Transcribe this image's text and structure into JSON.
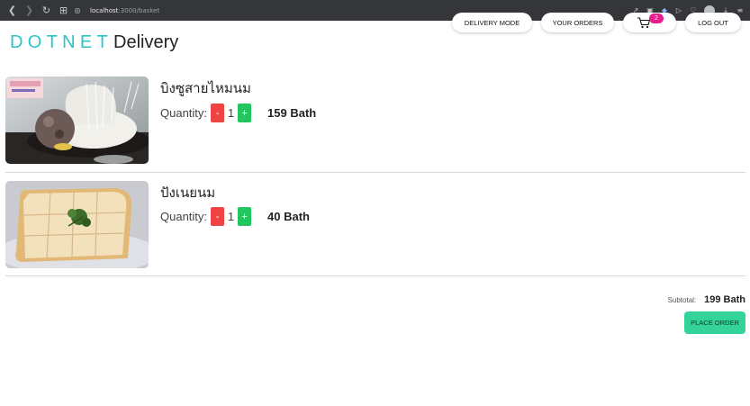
{
  "browser": {
    "url_host": "localhost",
    "url_path": ":3000/basket"
  },
  "header": {
    "brand_main": "DOTNET",
    "brand_sub": "Delivery",
    "brand_color": "#2ec4c4",
    "delivery_mode": "DELIVERY MODE",
    "your_orders": "YOUR ORDERS",
    "cart_count": "2",
    "logout": "LOG OUT"
  },
  "basket": {
    "quantity_label": "Quantity:",
    "minus": "-",
    "plus": "+",
    "items": [
      {
        "name": "บิงซูสายไหมนม",
        "quantity": "1",
        "price": "159 Bath",
        "image": "bingsu-photo"
      },
      {
        "name": "ปังเนยนม",
        "quantity": "1",
        "price": "40 Bath",
        "image": "toast-photo"
      }
    ],
    "subtotal_label": "Subtotal:",
    "subtotal_value": "199 Bath",
    "place_order": "PLACE ORDER"
  },
  "colors": {
    "minus": "#ef4444",
    "plus": "#22c55e",
    "place_order": "#34d399",
    "badge": "#e91e8c"
  }
}
